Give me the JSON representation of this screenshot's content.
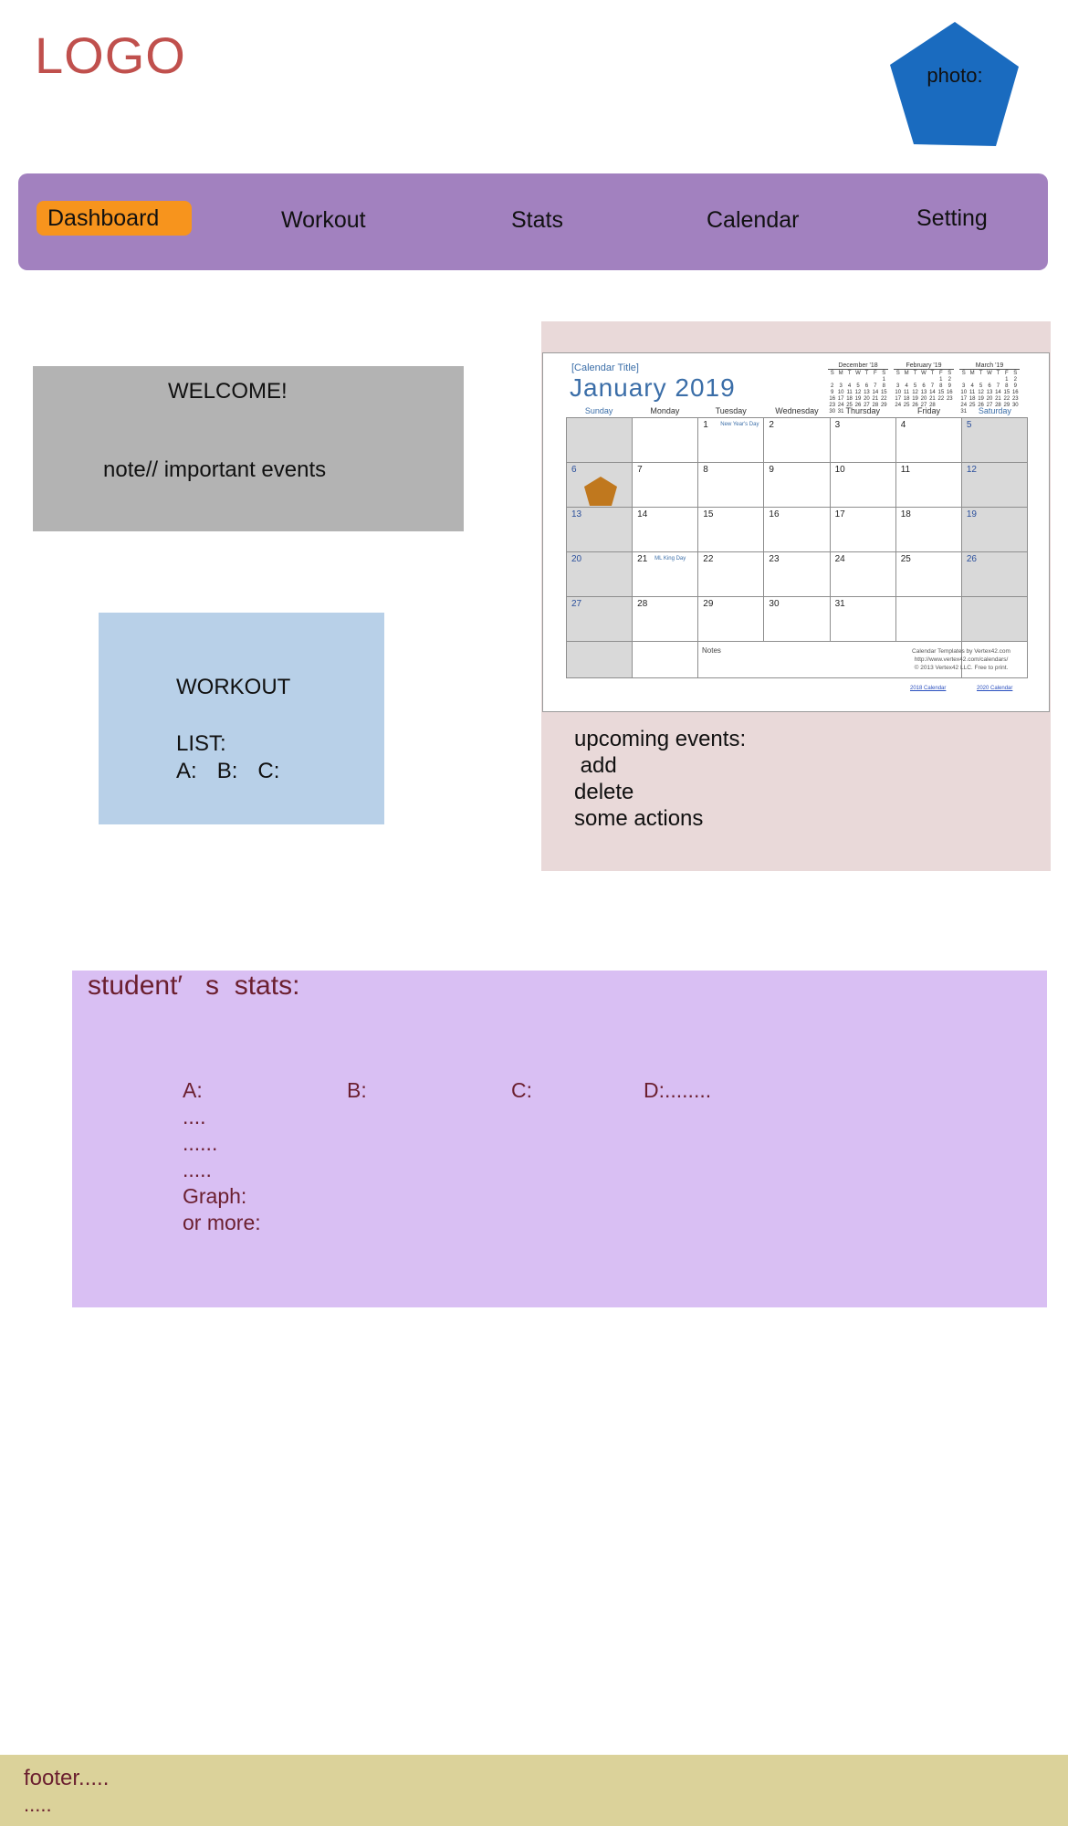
{
  "header": {
    "logo": "LOGO",
    "photo_label": "photo:",
    "photo_color": "#1a6bbf"
  },
  "nav": {
    "items": [
      {
        "label": "Dashboard",
        "active": true
      },
      {
        "label": "Workout"
      },
      {
        "label": "Stats"
      },
      {
        "label": "Calendar"
      },
      {
        "label": "Setting"
      }
    ],
    "active_color": "#f7941d",
    "bar_color": "#a281bf"
  },
  "welcome": {
    "title": "WELCOME!",
    "note": "note// important events"
  },
  "workout": {
    "title": "WORKOUT",
    "list_label": "LIST:",
    "items": [
      "A:",
      "B:",
      "C:"
    ]
  },
  "calendar": {
    "title_small": "[Calendar Title]",
    "title": "January  2019",
    "day_headers": [
      "Sunday",
      "Monday",
      "Tuesday",
      "Wednesday",
      "Thursday",
      "Friday",
      "Saturday"
    ],
    "weeks": [
      [
        "",
        "",
        "1",
        "2",
        "3",
        "4",
        "5"
      ],
      [
        "6",
        "7",
        "8",
        "9",
        "10",
        "11",
        "12"
      ],
      [
        "13",
        "14",
        "15",
        "16",
        "17",
        "18",
        "19"
      ],
      [
        "20",
        "21",
        "22",
        "23",
        "24",
        "25",
        "26"
      ],
      [
        "27",
        "28",
        "29",
        "30",
        "31",
        "",
        ""
      ]
    ],
    "events": {
      "1": "New Year's Day",
      "21": "ML King Day"
    },
    "notes_label": "Notes",
    "credit_lines": [
      "Calendar Templates by Vertex42.com",
      "http://www.vertex42.com/calendars/",
      "© 2013 Vertex42 LLC. Free to print."
    ],
    "links": [
      "2018 Calendar",
      "2020 Calendar"
    ],
    "mini_months": [
      {
        "name": "December '18",
        "days": [
          "S",
          "M",
          "T",
          "W",
          "T",
          "F",
          "S",
          "",
          "",
          "",
          "",
          "",
          "",
          "1",
          "2",
          "3",
          "4",
          "5",
          "6",
          "7",
          "8",
          "9",
          "10",
          "11",
          "12",
          "13",
          "14",
          "15",
          "16",
          "17",
          "18",
          "19",
          "20",
          "21",
          "22",
          "23",
          "24",
          "25",
          "26",
          "27",
          "28",
          "29",
          "30",
          "31",
          "",
          "",
          "",
          "",
          "",
          ""
        ]
      },
      {
        "name": "February '19",
        "days": [
          "S",
          "M",
          "T",
          "W",
          "T",
          "F",
          "S",
          "",
          "",
          "",
          "",
          "",
          "1",
          "2",
          "3",
          "4",
          "5",
          "6",
          "7",
          "8",
          "9",
          "10",
          "11",
          "12",
          "13",
          "14",
          "15",
          "16",
          "17",
          "18",
          "19",
          "20",
          "21",
          "22",
          "23",
          "24",
          "25",
          "26",
          "27",
          "28",
          "",
          ""
        ]
      },
      {
        "name": "March '19",
        "days": [
          "S",
          "M",
          "T",
          "W",
          "T",
          "F",
          "S",
          "",
          "",
          "",
          "",
          "",
          "1",
          "2",
          "3",
          "4",
          "5",
          "6",
          "7",
          "8",
          "9",
          "10",
          "11",
          "12",
          "13",
          "14",
          "15",
          "16",
          "17",
          "18",
          "19",
          "20",
          "21",
          "22",
          "23",
          "24",
          "25",
          "26",
          "27",
          "28",
          "29",
          "30",
          "31",
          "",
          "",
          "",
          "",
          "",
          ""
        ]
      }
    ],
    "marker_color": "#c0781e",
    "upcoming": [
      "upcoming events:",
      " add",
      "delete",
      "some actions"
    ]
  },
  "stats": {
    "title": "student′   s  stats:",
    "labels": [
      "A:",
      "B:",
      "C:",
      "D:........"
    ],
    "lines": [
      "....",
      "......",
      ".....",
      "Graph:",
      "or more:"
    ]
  },
  "footer": {
    "line1": "footer.....",
    "line2": "....."
  }
}
